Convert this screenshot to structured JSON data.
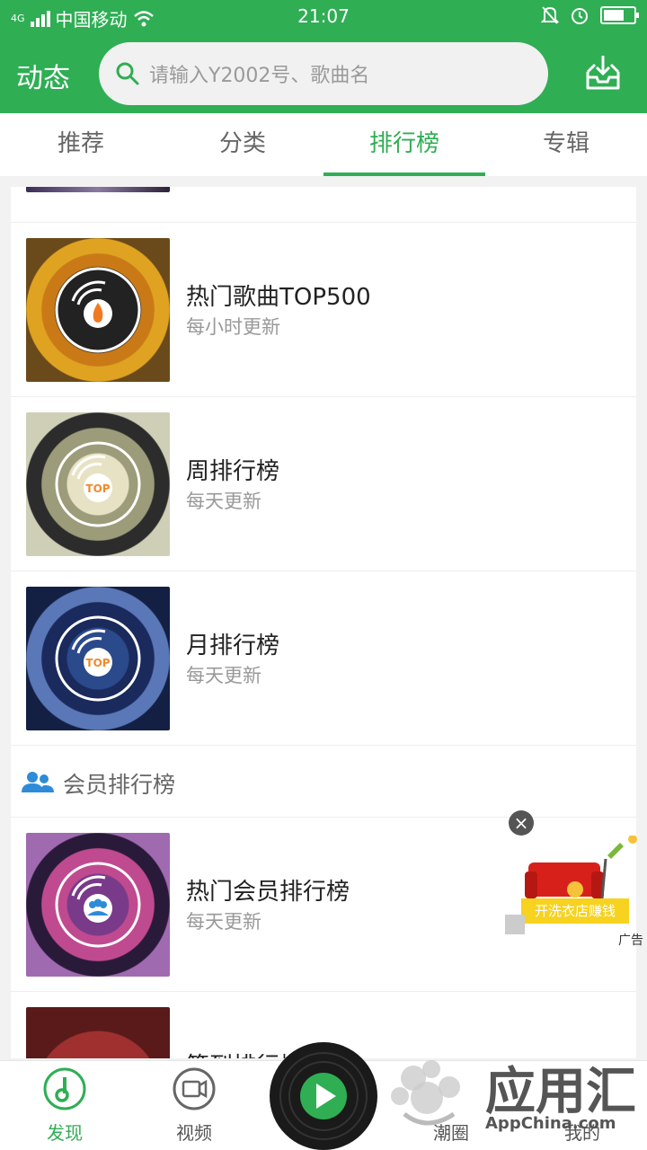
{
  "status_bar": {
    "network": "4G",
    "carrier": "中国移动",
    "time": "21:07"
  },
  "header": {
    "title": "动态",
    "search_placeholder": "请输入Y2002号、歌曲名",
    "download_icon": "download-icon"
  },
  "tabs": [
    {
      "label": "推荐",
      "active": false
    },
    {
      "label": "分类",
      "active": false
    },
    {
      "label": "排行榜",
      "active": true
    },
    {
      "label": "专辑",
      "active": false
    }
  ],
  "charts": [
    {
      "name": "热门歌曲TOP500",
      "subtitle": "每小时更新",
      "badge": "fire-icon"
    },
    {
      "name": "周排行榜",
      "subtitle": "每天更新",
      "badge": "TOP"
    },
    {
      "name": "月排行榜",
      "subtitle": "每天更新",
      "badge": "TOP"
    }
  ],
  "member_section": {
    "title": "会员排行榜",
    "items": [
      {
        "name": "热门会员排行榜",
        "subtitle": "每天更新",
        "badge": "users-icon"
      },
      {
        "name": "签到排行榜",
        "subtitle": "",
        "badge": ""
      }
    ]
  },
  "ad": {
    "banner_text": "开洗衣店赚钱",
    "tag": "广告"
  },
  "bottom_nav": [
    {
      "label": "发现",
      "active": true
    },
    {
      "label": "视频",
      "active": false
    },
    {
      "label": "",
      "active": false
    },
    {
      "label": "潮圈",
      "active": false
    },
    {
      "label": "我的",
      "active": false
    }
  ],
  "watermark": {
    "title": "应用汇",
    "subtitle": "AppChina.com"
  },
  "colors": {
    "brand_green": "#2fae54"
  }
}
